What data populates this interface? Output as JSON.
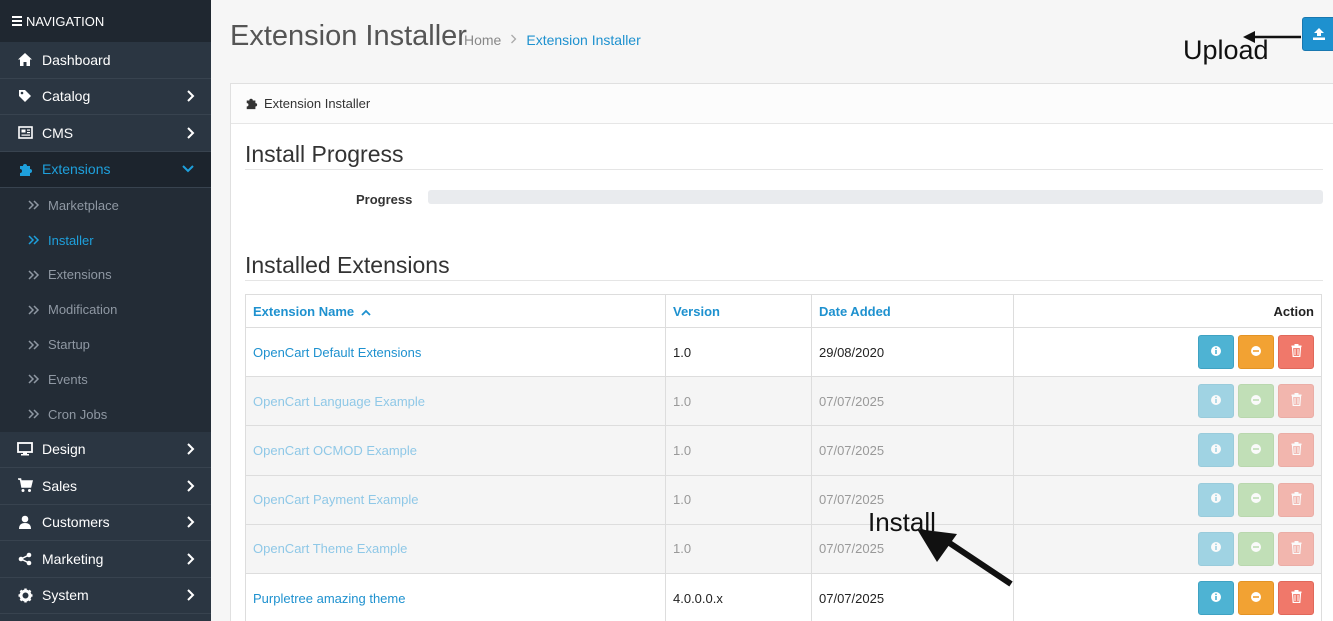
{
  "sidebar": {
    "header": "NAVIGATION",
    "items": [
      {
        "label": "Dashboard",
        "icon": "home-icon"
      },
      {
        "label": "Catalog",
        "icon": "tag-icon"
      },
      {
        "label": "CMS",
        "icon": "newspaper-icon"
      },
      {
        "label": "Extensions",
        "icon": "puzzle-icon"
      },
      {
        "label": "Design",
        "icon": "desktop-icon"
      },
      {
        "label": "Sales",
        "icon": "cart-icon"
      },
      {
        "label": "Customers",
        "icon": "user-icon"
      },
      {
        "label": "Marketing",
        "icon": "share-icon"
      },
      {
        "label": "System",
        "icon": "gear-icon"
      }
    ],
    "sub_items": [
      "Marketplace",
      "Installer",
      "Extensions",
      "Modification",
      "Startup",
      "Events",
      "Cron Jobs"
    ]
  },
  "header": {
    "title": "Extension Installer",
    "breadcrumb": [
      "Home",
      "Extension Installer"
    ]
  },
  "annotations": {
    "upload": "Upload",
    "install": "Install"
  },
  "panel": {
    "heading": "Extension Installer",
    "progress_title": "Install Progress",
    "progress_label": "Progress",
    "progress_value": 0,
    "installed_title": "Installed Extensions"
  },
  "table": {
    "columns": [
      "Extension Name",
      "Version",
      "Date Added",
      "Action"
    ],
    "rows": [
      {
        "name": "OpenCart Default Extensions",
        "version": "1.0",
        "date": "29/08/2020",
        "dim": false,
        "second": "uninstall"
      },
      {
        "name": "OpenCart Language Example",
        "version": "1.0",
        "date": "07/07/2025",
        "dim": true,
        "second": "install"
      },
      {
        "name": "OpenCart OCMOD Example",
        "version": "1.0",
        "date": "07/07/2025",
        "dim": true,
        "second": "install"
      },
      {
        "name": "OpenCart Payment Example",
        "version": "1.0",
        "date": "07/07/2025",
        "dim": true,
        "second": "install"
      },
      {
        "name": "OpenCart Theme Example",
        "version": "1.0",
        "date": "07/07/2025",
        "dim": true,
        "second": "install"
      },
      {
        "name": "Purpletree amazing theme",
        "version": "4.0.0.0.x",
        "date": "07/07/2025",
        "dim": false,
        "second": "uninstall"
      }
    ]
  },
  "colors": {
    "sidebar_bg": "#2b3642",
    "accent": "#1e91cf",
    "info": "#4eb3d3",
    "uninstall": "#f2a233",
    "install": "#8fcb7a",
    "delete": "#f0786a"
  }
}
